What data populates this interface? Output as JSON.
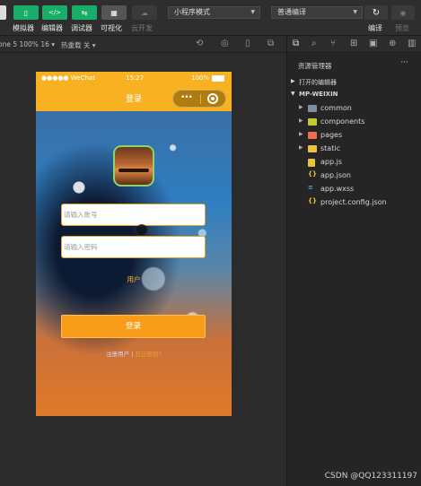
{
  "toolbar": {
    "buttons": [
      {
        "label": "模拟器",
        "icon": "phone-icon",
        "glyph": "▯"
      },
      {
        "label": "编辑器",
        "icon": "code-icon",
        "glyph": "</>"
      },
      {
        "label": "调试器",
        "icon": "debug-icon",
        "glyph": "⇆"
      },
      {
        "label": "可视化",
        "icon": "layout-icon",
        "glyph": "▦"
      },
      {
        "label": "云开发",
        "icon": "cloud-icon",
        "glyph": "☁"
      }
    ],
    "mode_select": "小程序模式",
    "compile_select": "普通编译",
    "compile_label": "编译",
    "preview_label": "预览"
  },
  "simbar": {
    "device": "one 5 100% 16 ▾",
    "hotreload": "热重载 关 ▾"
  },
  "phone": {
    "status_carrier": "●●●●● WeChat",
    "status_time": "15:27",
    "status_battery": "100%",
    "nav_title": "登录",
    "capsule_dots": "•••",
    "account_placeholder": "请输入账号",
    "password_placeholder": "请输入密码",
    "user_link": "用户",
    "login_button": "登录",
    "register_link": "注册用户",
    "link_separator": " | ",
    "forgot_link": "忘记密码?"
  },
  "explorer": {
    "title": "资源管理器",
    "more": "···",
    "open_editors": "打开的编辑器",
    "project": "MP-WEIXIN",
    "items": [
      {
        "name": "common",
        "type": "folder",
        "color": "#7f8fa6"
      },
      {
        "name": "components",
        "type": "folder",
        "color": "#c0ca33"
      },
      {
        "name": "pages",
        "type": "folder",
        "color": "#ef6c4a"
      },
      {
        "name": "static",
        "type": "folder",
        "color": "#f0c040"
      },
      {
        "name": "app.js",
        "type": "js",
        "color": "#e8c33a"
      },
      {
        "name": "app.json",
        "type": "json",
        "color": "#e8c33a"
      },
      {
        "name": "app.wxss",
        "type": "wxss",
        "color": "#4aa0e6"
      },
      {
        "name": "project.config.json",
        "type": "json",
        "color": "#e8c33a"
      }
    ]
  },
  "watermark": "CSDN @QQ123311197"
}
